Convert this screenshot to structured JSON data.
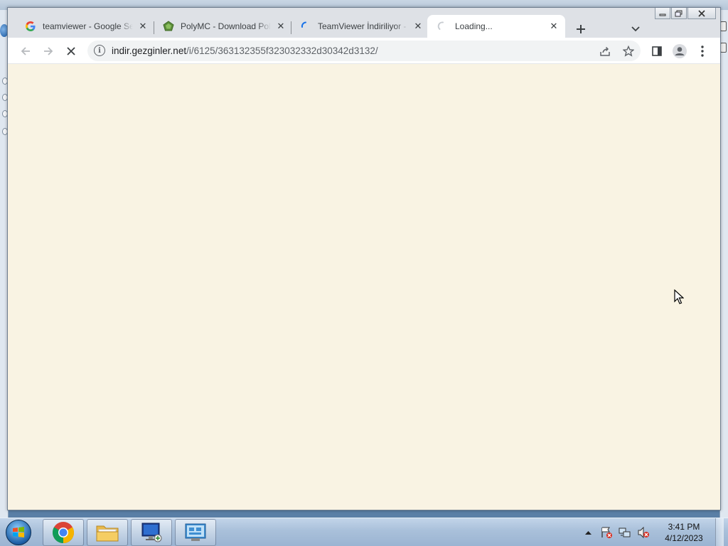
{
  "tabs": [
    {
      "title": "teamviewer - Google Se",
      "favicon": "google-g-icon",
      "active": false
    },
    {
      "title": "PolyMC - Download Pol",
      "favicon": "polymc-icon",
      "active": false
    },
    {
      "title": "TeamViewer İndiriliyor -",
      "favicon": "loading-spinner-icon",
      "active": false
    },
    {
      "title": "Loading...",
      "favicon": "loading-spinner-icon",
      "active": true
    }
  ],
  "toolbar": {
    "url_host": "indir.gezginler.net",
    "url_path": "/i/6125/363132355f323032332d30342d3132/",
    "loading": true
  },
  "page": {
    "background": "#f9f3e3"
  },
  "taskbar": {
    "items": [
      {
        "name": "chrome",
        "open": true
      },
      {
        "name": "file-explorer",
        "open": true
      },
      {
        "name": "remote-desktop",
        "open": true
      },
      {
        "name": "control-panel",
        "open": true
      }
    ],
    "clock": {
      "time": "3:41 PM",
      "date": "4/12/2023"
    }
  },
  "colors": {
    "tabstrip": "#dee1e6",
    "active_tab": "#ffffff",
    "omnibox": "#f1f3f4",
    "taskbar": "#a9c0da"
  }
}
